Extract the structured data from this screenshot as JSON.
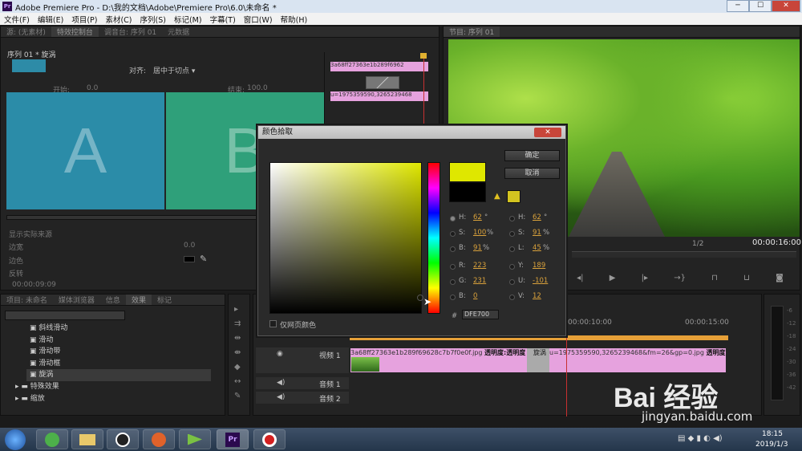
{
  "window": {
    "title": "Adobe Premiere Pro - D:\\我的文档\\Adobe\\Premiere Pro\\6.0\\未命名 *"
  },
  "menu": [
    "文件(F)",
    "编辑(E)",
    "项目(P)",
    "素材(C)",
    "序列(S)",
    "标记(M)",
    "字幕(T)",
    "窗口(W)",
    "帮助(H)"
  ],
  "effect_controls": {
    "tabs": [
      "源: (无素材)",
      "特效控制台",
      "调音台: 序列 01",
      "元数据"
    ],
    "sequence_label": "序列 01 * 旋涡",
    "align_label": "对齐:",
    "align_value": "居中于切点",
    "start_label": "开始:",
    "start_value": "0.0",
    "end_label": "结束:",
    "end_value": "100.0",
    "tile_a": "A",
    "tile_b": "B",
    "show_actual_sources": "显示实际来源",
    "border_label": "边宽",
    "border_value": "0.0",
    "border_color_label": "边色",
    "reverse_label": "反转",
    "timecode": "00:00:09:09",
    "mini_clip_a": "3a68ff27363e1b289f6962",
    "mini_clip_b": "u=1975359590,3265239468"
  },
  "program_monitor": {
    "tab": "节目: 序列 01",
    "fraction": "1/2",
    "timecode": "00:00:16:00"
  },
  "effects_panel": {
    "tabs": [
      "项目: 未命名",
      "媒体浏览器",
      "信息",
      "效果",
      "标记"
    ],
    "items": [
      "斜线滑动",
      "滑动",
      "滑动带",
      "滑动框",
      "旋涡"
    ],
    "folders": [
      "特殊效果",
      "缩放"
    ]
  },
  "timeline": {
    "ruler": [
      "00:00:10:00",
      "00:00:15:00"
    ],
    "tracks": [
      {
        "name": "视频 1"
      },
      {
        "name": "音频 1"
      },
      {
        "name": "音频 2"
      }
    ],
    "clip_a_label": "3a68ff27363e1b289f69628c7b7f0e0f.jpg",
    "clip_a_fx": "透明度:透明度",
    "transition_label": "旋涡",
    "clip_b_label": "u=1975359590,3265239468&fm=26&gp=0.jpg",
    "clip_b_fx": "透明度:透明度"
  },
  "dialog": {
    "title": "颜色拾取",
    "close": "✕",
    "ok": "确定",
    "cancel": "取消",
    "web_only": "仅网页颜色",
    "hex_label": "#",
    "hex_value": "DFE700",
    "new_color": "#dfe700",
    "old_color": "#000000",
    "hsb": [
      {
        "label": "H:",
        "value": "62",
        "unit": "°"
      },
      {
        "label": "S:",
        "value": "100",
        "unit": "%"
      },
      {
        "label": "B:",
        "value": "91",
        "unit": "%"
      }
    ],
    "rgb": [
      {
        "label": "R:",
        "value": "223"
      },
      {
        "label": "G:",
        "value": "231"
      },
      {
        "label": "B:",
        "value": "0"
      }
    ],
    "hsl": [
      {
        "label": "H:",
        "value": "62",
        "unit": "°"
      },
      {
        "label": "S:",
        "value": "91",
        "unit": "%"
      },
      {
        "label": "L:",
        "value": "45",
        "unit": "%"
      }
    ],
    "yuv": [
      {
        "label": "Y:",
        "value": "189"
      },
      {
        "label": "U:",
        "value": "-101"
      },
      {
        "label": "V:",
        "value": "12"
      }
    ]
  },
  "taskbar": {
    "time": "18:15",
    "date": "2019/1/3"
  },
  "watermark": {
    "brand": "Bai 经验",
    "url": "jingyan.baidu.com"
  }
}
